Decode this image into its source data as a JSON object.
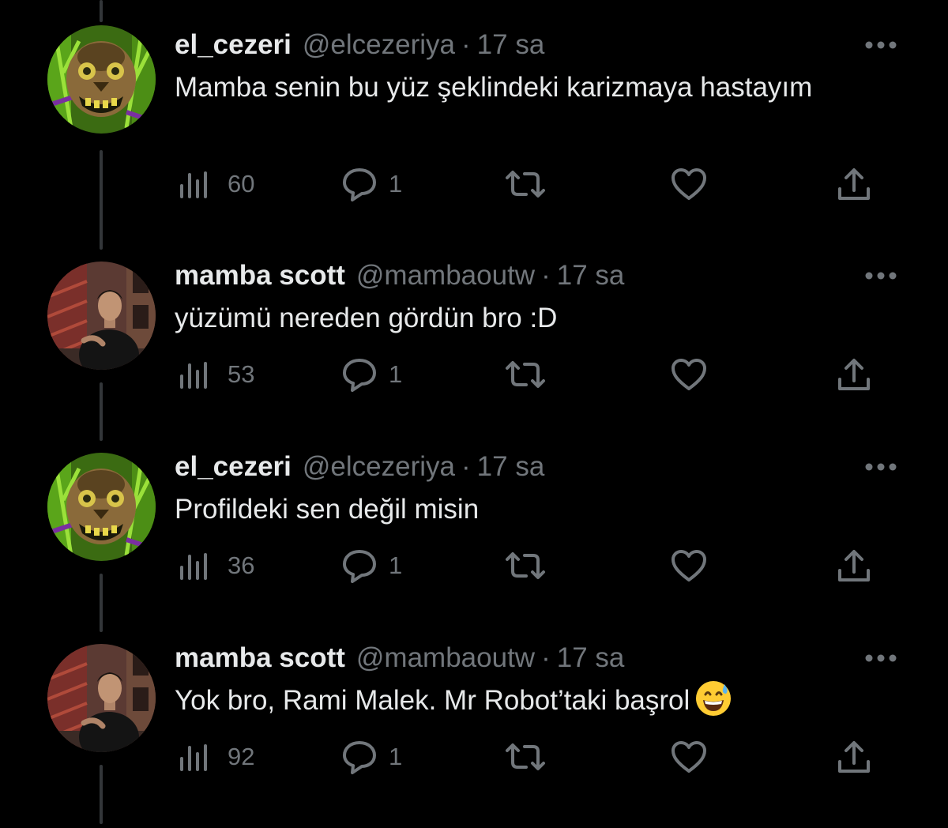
{
  "colors": {
    "background": "#000000",
    "primary_text": "#e7e9ea",
    "secondary_text": "#71767b",
    "thread_line": "#333639"
  },
  "icons": {
    "more": "more-dots-icon",
    "views": "views-bar-chart-icon",
    "reply": "reply-bubble-icon",
    "retweet": "retweet-icon",
    "like": "heart-icon",
    "share": "share-upload-icon"
  },
  "tweets": [
    {
      "name": "el_cezeri",
      "handle": "@elcezeriya",
      "separator": "·",
      "time": "17 sa",
      "text": "Mamba senin bu yüz şeklindeki karizmaya hastayım",
      "views": "60",
      "replies": "1"
    },
    {
      "name": "mamba scott",
      "handle": "@mambaoutw",
      "separator": "·",
      "time": "17 sa",
      "text": "yüzümü nereden gördün bro :D",
      "views": "53",
      "replies": "1"
    },
    {
      "name": "el_cezeri",
      "handle": "@elcezeriya",
      "separator": "·",
      "time": "17 sa",
      "text": "Profildeki sen değil misin",
      "views": "36",
      "replies": "1"
    },
    {
      "name": "mamba scott",
      "handle": "@mambaoutw",
      "separator": "·",
      "time": "17 sa",
      "text": "Yok bro, Rami Malek. Mr Robot’taki başrol",
      "emoji": "grinning-face-with-sweat-emoji",
      "views": "92",
      "replies": "1"
    }
  ]
}
